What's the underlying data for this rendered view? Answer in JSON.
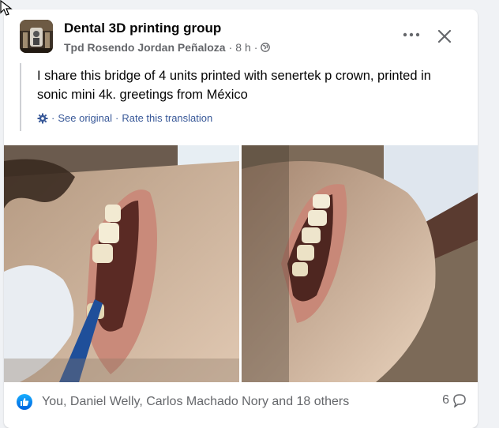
{
  "post": {
    "group_name": "Dental 3D printing group",
    "author": "Tpd Rosendo Jordan Peñaloza",
    "separator": "·",
    "time": "8 h",
    "audience_icon": "globe-icon",
    "text": "I share this bridge of 4 units printed with senertek p crown, printed in sonic mini 4k. greetings from México",
    "translation": {
      "see_original": "See original",
      "rate": "Rate this translation",
      "dot": "·"
    }
  },
  "footer": {
    "reactions_text": "You, Daniel Welly, Carlos Machado Nory and 18 others",
    "comment_count": "6"
  },
  "colors": {
    "link": "#385898",
    "meta": "#65676b",
    "like_blue": "#0866ff"
  }
}
